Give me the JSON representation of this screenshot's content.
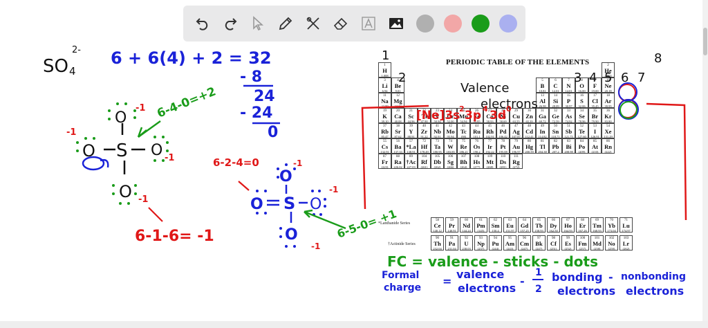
{
  "toolbar": {
    "tools": [
      {
        "name": "undo-icon",
        "glyph": "undo"
      },
      {
        "name": "redo-icon",
        "glyph": "redo"
      },
      {
        "name": "select-icon",
        "glyph": "select"
      },
      {
        "name": "pen-icon",
        "glyph": "pen"
      },
      {
        "name": "tools-icon",
        "glyph": "tools"
      },
      {
        "name": "eraser-icon",
        "glyph": "eraser"
      },
      {
        "name": "text-icon",
        "glyph": "A"
      },
      {
        "name": "image-icon",
        "glyph": "image"
      }
    ],
    "colors": [
      "#b0b0b0",
      "#f2a7a7",
      "#1a9c1a",
      "#aab0f0"
    ]
  },
  "whiteboard": {
    "formula": "SO",
    "formula_sub": "4",
    "formula_sup": "2-",
    "electron_count": "6 + 6(4) + 2 = 32",
    "minus_8": "- 8",
    "result_24": "24",
    "minus_24": "- 24",
    "result_0": "0",
    "fc_s_left": "6-4-0=+2",
    "fc_o_right_top": "6-2-4=0",
    "fc_o_bottom": "6-1-6= -1",
    "fc_s_right": "6-5-0= +1",
    "valence_title_1": "Valence",
    "valence_title_2": "electrons",
    "config": "[Ne]3s",
    "config_sup1": "2",
    "config_p": "3p",
    "config_sup2": "4",
    "config_d": "3d",
    "config_sup3": "0",
    "fc_def": "FC  =  valence - sticks - dots",
    "fc_full_1": "Formal",
    "fc_full_2": "charge",
    "fc_valence_1": "valence",
    "fc_valence_2": "electrons",
    "fc_half_n": "1",
    "fc_half_d": "2",
    "fc_bonding_1": "bonding",
    "fc_bonding_2": "electrons",
    "fc_nonbond_1": "nonbonding",
    "fc_nonbond_2": "electrons",
    "group_labels": [
      "1",
      "2",
      "3",
      "4",
      "5",
      "6",
      "7",
      "8"
    ],
    "charges": [
      "-1",
      "-1",
      "-1",
      "-1",
      "-1",
      "-1",
      "-1"
    ],
    "atoms": [
      "O",
      "S",
      "O",
      "O",
      "O",
      "O",
      "S",
      "O",
      "O"
    ]
  },
  "periodic_table": {
    "title": "PERIODIC TABLE OF THE ELEMENTS",
    "lanthanide_label": "*Lanthanide Series",
    "actinide_label": "†Actinide Series",
    "cells": [
      [
        "1",
        "H",
        "1.008",
        0,
        0
      ],
      [
        "2",
        "He",
        "4.003",
        17,
        0
      ],
      [
        "3",
        "Li",
        "6.94",
        0,
        1
      ],
      [
        "4",
        "Be",
        "9.01",
        1,
        1
      ],
      [
        "5",
        "B",
        "10.81",
        12,
        1
      ],
      [
        "6",
        "C",
        "12.01",
        13,
        1
      ],
      [
        "7",
        "N",
        "14.01",
        14,
        1
      ],
      [
        "8",
        "O",
        "16.00",
        15,
        1
      ],
      [
        "9",
        "F",
        "19.00",
        16,
        1
      ],
      [
        "10",
        "Ne",
        "20.18",
        17,
        1
      ],
      [
        "11",
        "Na",
        "22.99",
        0,
        2
      ],
      [
        "12",
        "Mg",
        "24.30",
        1,
        2
      ],
      [
        "13",
        "Al",
        "26.98",
        12,
        2
      ],
      [
        "14",
        "Si",
        "28.09",
        13,
        2
      ],
      [
        "15",
        "P",
        "30.97",
        14,
        2
      ],
      [
        "16",
        "S",
        "32.06",
        15,
        2
      ],
      [
        "17",
        "Cl",
        "35.45",
        16,
        2
      ],
      [
        "18",
        "Ar",
        "39.95",
        17,
        2
      ],
      [
        "19",
        "K",
        "39.10",
        0,
        3
      ],
      [
        "20",
        "Ca",
        "40.08",
        1,
        3
      ],
      [
        "21",
        "Sc",
        "44.96",
        2,
        3
      ],
      [
        "22",
        "Ti",
        "47.90",
        3,
        3
      ],
      [
        "23",
        "V",
        "50.94",
        4,
        3
      ],
      [
        "24",
        "Cr",
        "52.00",
        5,
        3
      ],
      [
        "25",
        "Mn",
        "54.94",
        6,
        3
      ],
      [
        "26",
        "Fe",
        "55.85",
        7,
        3
      ],
      [
        "27",
        "Co",
        "58.93",
        8,
        3
      ],
      [
        "28",
        "Ni",
        "58.69",
        9,
        3
      ],
      [
        "29",
        "Cu",
        "63.55",
        10,
        3
      ],
      [
        "30",
        "Zn",
        "65.39",
        11,
        3
      ],
      [
        "31",
        "Ga",
        "69.72",
        12,
        3
      ],
      [
        "32",
        "Ge",
        "72.59",
        13,
        3
      ],
      [
        "33",
        "As",
        "74.92",
        14,
        3
      ],
      [
        "34",
        "Se",
        "78.96",
        15,
        3
      ],
      [
        "35",
        "Br",
        "79.90",
        16,
        3
      ],
      [
        "36",
        "Kr",
        "83.80",
        17,
        3
      ],
      [
        "37",
        "Rb",
        "85.47",
        0,
        4
      ],
      [
        "38",
        "Sr",
        "87.62",
        1,
        4
      ],
      [
        "39",
        "Y",
        "88.91",
        2,
        4
      ],
      [
        "40",
        "Zr",
        "91.22",
        3,
        4
      ],
      [
        "41",
        "Nb",
        "92.91",
        4,
        4
      ],
      [
        "42",
        "Mo",
        "95.94",
        5,
        4
      ],
      [
        "43",
        "Tc",
        "(98)",
        6,
        4
      ],
      [
        "44",
        "Ru",
        "101.1",
        7,
        4
      ],
      [
        "45",
        "Rh",
        "102.91",
        8,
        4
      ],
      [
        "46",
        "Pd",
        "106.42",
        9,
        4
      ],
      [
        "47",
        "Ag",
        "107.87",
        10,
        4
      ],
      [
        "48",
        "Cd",
        "112.41",
        11,
        4
      ],
      [
        "49",
        "In",
        "114.82",
        12,
        4
      ],
      [
        "50",
        "Sn",
        "118.71",
        13,
        4
      ],
      [
        "51",
        "Sb",
        "121.75",
        14,
        4
      ],
      [
        "52",
        "Te",
        "127.60",
        15,
        4
      ],
      [
        "53",
        "I",
        "126.91",
        16,
        4
      ],
      [
        "54",
        "Xe",
        "131.29",
        17,
        4
      ],
      [
        "55",
        "Cs",
        "132.91",
        0,
        5
      ],
      [
        "56",
        "Ba",
        "137.33",
        1,
        5
      ],
      [
        "57",
        "*La",
        "138.91",
        2,
        5
      ],
      [
        "72",
        "Hf",
        "178.49",
        3,
        5
      ],
      [
        "73",
        "Ta",
        "180.95",
        4,
        5
      ],
      [
        "74",
        "W",
        "183.85",
        5,
        5
      ],
      [
        "75",
        "Re",
        "186.21",
        6,
        5
      ],
      [
        "76",
        "Os",
        "190.2",
        7,
        5
      ],
      [
        "77",
        "Ir",
        "192.22",
        8,
        5
      ],
      [
        "78",
        "Pt",
        "195.08",
        9,
        5
      ],
      [
        "79",
        "Au",
        "196.97",
        10,
        5
      ],
      [
        "80",
        "Hg",
        "200.59",
        11,
        5
      ],
      [
        "81",
        "Tl",
        "204.38",
        12,
        5
      ],
      [
        "82",
        "Pb",
        "207.2",
        13,
        5
      ],
      [
        "83",
        "Bi",
        "208.98",
        14,
        5
      ],
      [
        "84",
        "Po",
        "(209)",
        15,
        5
      ],
      [
        "85",
        "At",
        "(210)",
        16,
        5
      ],
      [
        "86",
        "Rn",
        "(222)",
        17,
        5
      ],
      [
        "87",
        "Fr",
        "(223)",
        0,
        6
      ],
      [
        "88",
        "Ra",
        "226.02",
        1,
        6
      ],
      [
        "89",
        "†Ac",
        "227.03",
        2,
        6
      ],
      [
        "104",
        "Rf",
        "(261)",
        3,
        6
      ],
      [
        "105",
        "Db",
        "(262)",
        4,
        6
      ],
      [
        "106",
        "Sg",
        "(266)",
        5,
        6
      ],
      [
        "107",
        "Bh",
        "(264)",
        6,
        6
      ],
      [
        "108",
        "Hs",
        "(277)",
        7,
        6
      ],
      [
        "109",
        "Mt",
        "(268)",
        8,
        6
      ],
      [
        "110",
        "Ds",
        "(281)",
        9,
        6
      ],
      [
        "111",
        "Rg",
        "(272)",
        10,
        6
      ]
    ],
    "lanthanides": [
      [
        "58",
        "Ce",
        "140.12"
      ],
      [
        "59",
        "Pr",
        "140.91"
      ],
      [
        "60",
        "Nd",
        "144.24"
      ],
      [
        "61",
        "Pm",
        "(145)"
      ],
      [
        "62",
        "Sm",
        "150.4"
      ],
      [
        "63",
        "Eu",
        "151.97"
      ],
      [
        "64",
        "Gd",
        "157.25"
      ],
      [
        "65",
        "Tb",
        "158.93"
      ],
      [
        "66",
        "Dy",
        "162.50"
      ],
      [
        "67",
        "Ho",
        "164.93"
      ],
      [
        "68",
        "Er",
        "167.26"
      ],
      [
        "69",
        "Tm",
        "168.93"
      ],
      [
        "70",
        "Yb",
        "173.04"
      ],
      [
        "71",
        "Lu",
        "174.97"
      ]
    ],
    "actinides": [
      [
        "90",
        "Th",
        "232.04"
      ],
      [
        "91",
        "Pa",
        "231.04"
      ],
      [
        "92",
        "U",
        "238.03"
      ],
      [
        "93",
        "Np",
        "(237)"
      ],
      [
        "94",
        "Pu",
        "(244)"
      ],
      [
        "95",
        "Am",
        "(243)"
      ],
      [
        "96",
        "Cm",
        "(247)"
      ],
      [
        "97",
        "Bk",
        "(247)"
      ],
      [
        "98",
        "Cf",
        "(251)"
      ],
      [
        "99",
        "Es",
        "(252)"
      ],
      [
        "100",
        "Fm",
        "(257)"
      ],
      [
        "101",
        "Md",
        "(258)"
      ],
      [
        "102",
        "No",
        "(259)"
      ],
      [
        "103",
        "Lr",
        "(262)"
      ]
    ]
  }
}
